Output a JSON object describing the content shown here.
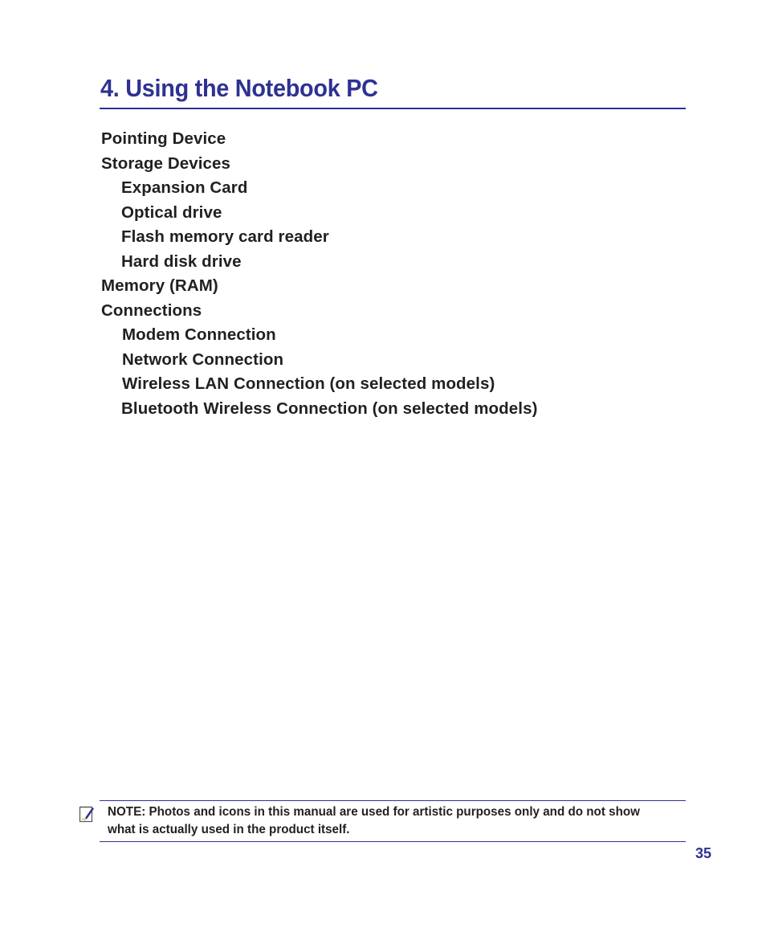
{
  "page": {
    "title": "4. Using the Notebook PC",
    "toc": [
      {
        "label": "Pointing Device",
        "level": 1
      },
      {
        "label": "Storage Devices",
        "level": 1
      },
      {
        "label": "Expansion Card",
        "level": 2
      },
      {
        "label": "Optical drive",
        "level": 2
      },
      {
        "label": "Flash memory card reader",
        "level": 2
      },
      {
        "label": "Hard disk drive",
        "level": 2
      },
      {
        "label": "Memory (RAM)",
        "level": 1
      },
      {
        "label": "Connections",
        "level": 1
      },
      {
        "label": "Modem Connection",
        "level": 2
      },
      {
        "label": "Network Connection",
        "level": 2
      },
      {
        "label": "Wireless LAN Connection (on selected models)",
        "level": 2
      },
      {
        "label": "Bluetooth Wireless Connection (on selected models)",
        "level": 2
      }
    ],
    "note": {
      "icon": "notepad-pen-icon",
      "text": "NOTE: Photos and icons in this manual are used for artistic purposes only and do not show what is actually used in the product itself."
    },
    "page_number": "35",
    "colors": {
      "accent": "#2e3192",
      "text": "#231f20"
    }
  }
}
